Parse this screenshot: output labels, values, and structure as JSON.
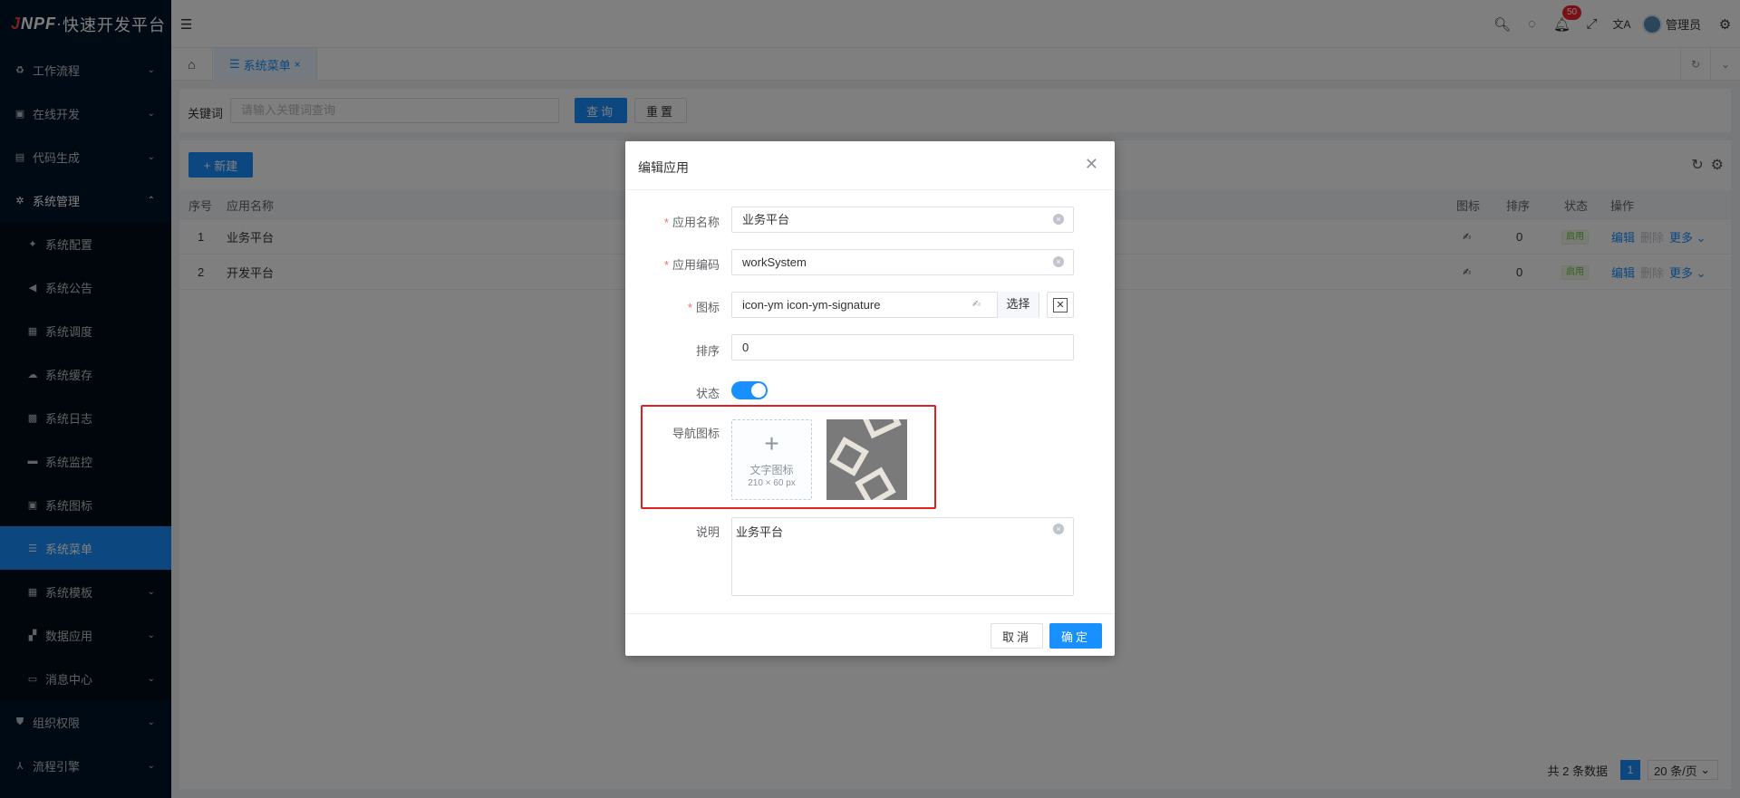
{
  "app": {
    "logo_brand": "JNPF",
    "logo_sep": "·",
    "logo_text": "快速开发平台"
  },
  "sidebar": {
    "items": [
      {
        "label": "工作流程",
        "icon": "workflow-icon"
      },
      {
        "label": "在线开发",
        "icon": "dev-icon"
      },
      {
        "label": "代码生成",
        "icon": "code-icon"
      },
      {
        "label": "系统管理",
        "icon": "gear-icon"
      }
    ],
    "sub_items": [
      {
        "label": "系统配置"
      },
      {
        "label": "系统公告"
      },
      {
        "label": "系统调度"
      },
      {
        "label": "系统缓存"
      },
      {
        "label": "系统日志"
      },
      {
        "label": "系统监控"
      },
      {
        "label": "系统图标"
      },
      {
        "label": "系统菜单"
      },
      {
        "label": "系统模板"
      },
      {
        "label": "数据应用"
      },
      {
        "label": "消息中心"
      }
    ],
    "bottom_items": [
      {
        "label": "组织权限"
      },
      {
        "label": "流程引擎"
      }
    ]
  },
  "header": {
    "badge_count": "50",
    "user_name": "管理员"
  },
  "tabs": {
    "active_label": "系统菜单"
  },
  "search": {
    "keyword_label": "关键词",
    "keyword_placeholder": "请输入关键词查询",
    "query_btn": "查询",
    "reset_btn": "重置"
  },
  "table": {
    "new_btn": "新建",
    "columns": {
      "index": "序号",
      "name": "应用名称",
      "icon": "图标",
      "sort": "排序",
      "status": "状态",
      "ops": "操作"
    },
    "rows": [
      {
        "index": "1",
        "name": "业务平台",
        "sort": "0",
        "status": "启用"
      },
      {
        "index": "2",
        "name": "开发平台",
        "sort": "0",
        "status": "启用"
      }
    ],
    "ops": {
      "edit": "编辑",
      "delete": "删除",
      "more": "更多"
    },
    "pager": {
      "total": "共 2 条数据",
      "page": "1",
      "size": "20 条/页"
    }
  },
  "dialog": {
    "title": "编辑应用",
    "name_label": "应用名称",
    "name_value": "业务平台",
    "code_label": "应用编码",
    "code_value": "workSystem",
    "icon_label": "图标",
    "icon_value": "icon-ym icon-ym-signature",
    "icon_select_btn": "选择",
    "sort_label": "排序",
    "sort_value": "0",
    "status_label": "状态",
    "status_on": true,
    "nav_icon_label": "导航图标",
    "upload_text": "文字图标",
    "upload_hint": "210 × 60 px",
    "desc_label": "说明",
    "desc_value": "业务平台",
    "cancel_btn": "取消",
    "confirm_btn": "确定"
  }
}
